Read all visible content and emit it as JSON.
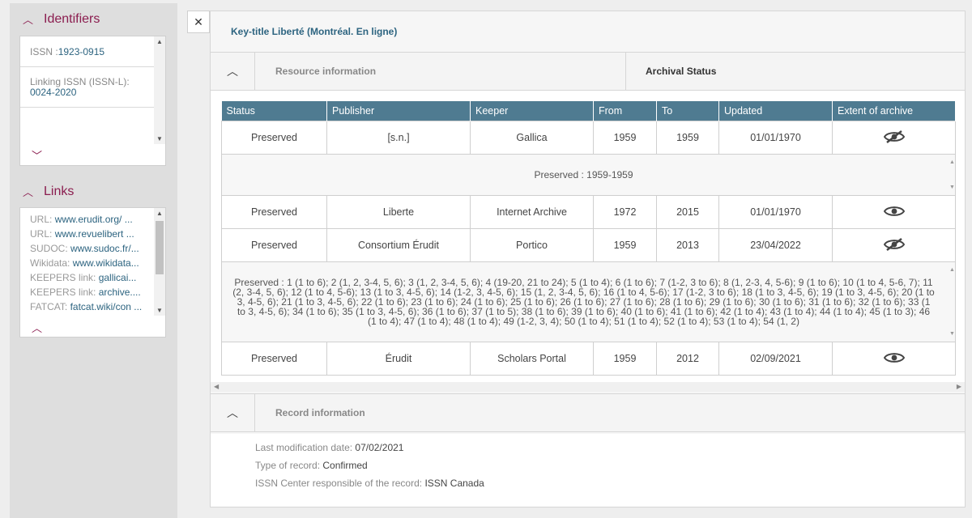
{
  "sidebar": {
    "identifiers_title": "Identifiers",
    "issn_label": "ISSN :",
    "issn_value": "1923-0915",
    "linking_label": "Linking ISSN (ISSN-L):",
    "linking_value": "0024-2020",
    "links_title": "Links",
    "links": [
      {
        "label": "URL: ",
        "value": "www.erudit.org/ ..."
      },
      {
        "label": "URL: ",
        "value": "www.revuelibert ..."
      },
      {
        "label": "SUDOC: ",
        "value": "www.sudoc.fr/..."
      },
      {
        "label": "Wikidata: ",
        "value": "www.wikidata..."
      },
      {
        "label": "KEEPERS link: ",
        "value": "gallicai..."
      },
      {
        "label": "KEEPERS link: ",
        "value": "archive...."
      },
      {
        "label": "FATCAT: ",
        "value": "fatcat.wiki/con ..."
      }
    ]
  },
  "main": {
    "close": "✕",
    "key_title": "Key-title Liberté (Montréal. En ligne)",
    "resource_label": "Resource information",
    "archival_label": "Archival Status",
    "record_label": "Record information"
  },
  "table": {
    "headers": [
      "Status",
      "Publisher",
      "Keeper",
      "From",
      "To",
      "Updated",
      "Extent of archive"
    ],
    "rows": [
      {
        "status": "Preserved",
        "publisher": "[s.n.]",
        "keeper": "Gallica",
        "from": "1959",
        "to": "1959",
        "updated": "01/01/1970",
        "icon": "eye-off-icon"
      },
      {
        "status": "Preserved",
        "publisher": "Liberte",
        "keeper": "Internet Archive",
        "from": "1972",
        "to": "2015",
        "updated": "01/01/1970",
        "icon": "eye-icon"
      },
      {
        "status": "Preserved",
        "publisher": "Consortium Érudit",
        "keeper": "Portico",
        "from": "1959",
        "to": "2013",
        "updated": "23/04/2022",
        "icon": "eye-off-icon"
      },
      {
        "status": "Preserved",
        "publisher": "Érudit",
        "keeper": "Scholars Portal",
        "from": "1959",
        "to": "2012",
        "updated": "02/09/2021",
        "icon": "eye-icon"
      }
    ],
    "detail_1": "Preserved : 1959-1959",
    "detail_3": "Preserved : 1 (1 to 6); 2 (1, 2, 3-4, 5, 6); 3 (1, 2, 3-4, 5, 6); 4 (19-20, 21 to 24); 5 (1 to 4); 6 (1 to 6); 7 (1-2, 3 to 6); 8 (1, 2-3, 4, 5-6); 9 (1 to 6); 10 (1 to 4, 5-6, 7); 11 (2, 3-4, 5, 6); 12 (1 to 4, 5-6); 13 (1 to 3, 4-5, 6); 14 (1-2, 3, 4-5, 6); 15 (1, 2, 3-4, 5, 6); 16 (1 to 4, 5-6); 17 (1-2, 3 to 6); 18 (1 to 3, 4-5, 6); 19 (1 to 3, 4-5, 6); 20 (1 to 3, 4-5, 6); 21 (1 to 3, 4-5, 6); 22 (1 to 6); 23 (1 to 6); 24 (1 to 6); 25 (1 to 6); 26 (1 to 6); 27 (1 to 6); 28 (1 to 6); 29 (1 to 6); 30 (1 to 6); 31 (1 to 6); 32 (1 to 6); 33 (1 to 3, 4-5, 6); 34 (1 to 6); 35 (1 to 3, 4-5, 6); 36 (1 to 6); 37 (1 to 5); 38 (1 to 6); 39 (1 to 6); 40 (1 to 6); 41 (1 to 6); 42 (1 to 4); 43 (1 to 4); 44 (1 to 4); 45 (1 to 3); 46 (1 to 4); 47 (1 to 4); 48 (1 to 4); 49 (1-2, 3, 4); 50 (1 to 4); 51 (1 to 4); 52 (1 to 4); 53 (1 to 4); 54 (1, 2)"
  },
  "record": {
    "mod_label": "Last modification date: ",
    "mod_value": "07/02/2021",
    "type_label": "Type of record: ",
    "type_value": "Confirmed",
    "center_label": "ISSN Center responsible of the record: ",
    "center_value": "ISSN Canada"
  }
}
